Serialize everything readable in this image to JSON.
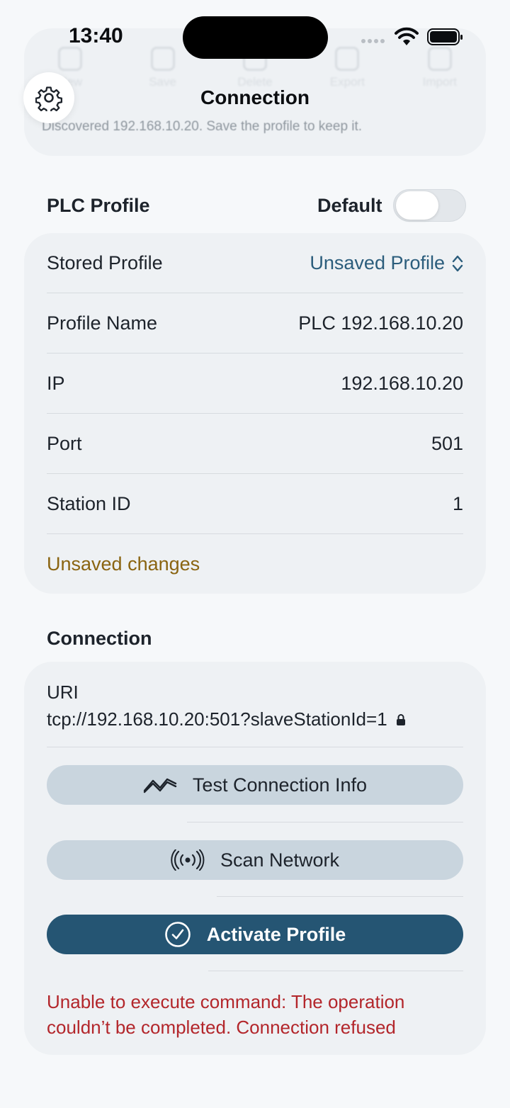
{
  "status_bar": {
    "time": "13:40"
  },
  "nav": {
    "title": "Connection",
    "settings_icon": "gear-icon"
  },
  "toolbar_ghost": {
    "items": [
      "New",
      "Save",
      "Delete",
      "Export",
      "Import"
    ],
    "discovered_text": "Discovered 192.168.10.20. Save the profile to keep it."
  },
  "plc_profile": {
    "header": "PLC Profile",
    "default_label": "Default",
    "default_on": false,
    "rows": {
      "stored_profile_label": "Stored Profile",
      "stored_profile_value": "Unsaved Profile",
      "profile_name_label": "Profile Name",
      "profile_name_value": "PLC 192.168.10.20",
      "ip_label": "IP",
      "ip_value": "192.168.10.20",
      "port_label": "Port",
      "port_value": "501",
      "station_label": "Station ID",
      "station_value": "1"
    },
    "unsaved_text": "Unsaved changes"
  },
  "connection": {
    "header": "Connection",
    "uri_label": "URI",
    "uri_value": "tcp://192.168.10.20:501?slaveStationId=1",
    "test_button": "Test Connection Info",
    "scan_button": "Scan Network",
    "activate_button": "Activate Profile",
    "error_text": "Unable to execute command: The operation couldn’t be completed. Connection refused"
  },
  "colors": {
    "accent": "#255573",
    "link": "#2b5d7c",
    "warning": "#8a6411",
    "error": "#b3262b",
    "card_bg": "#eef1f4"
  }
}
